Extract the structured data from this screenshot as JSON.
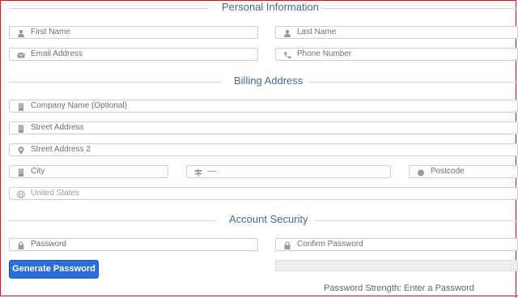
{
  "sections": {
    "personal": "Personal Information",
    "billing": "Billing Address",
    "security": "Account Security"
  },
  "fields": {
    "first_name": "First Name",
    "last_name": "Last Name",
    "email": "Email Address",
    "phone": "Phone Number",
    "company": "Company Name (Optional)",
    "street1": "Street Address",
    "street2": "Street Address 2",
    "city": "City",
    "state": "—",
    "postcode": "Postcode",
    "country": "United States",
    "password": "Password",
    "confirm_password": "Confirm Password"
  },
  "buttons": {
    "generate_password": "Generate Password"
  },
  "password_strength": {
    "text": "Password Strength: Enter a Password",
    "fill_percent": 0
  },
  "colors": {
    "section_title": "#456b8c",
    "button": "#2a6fd6",
    "frame": "#e0101a"
  },
  "icons": {
    "first_name": "user-icon",
    "last_name": "user-icon",
    "email": "envelope-icon",
    "phone": "phone-icon",
    "company": "building-icon",
    "street1": "building-icon",
    "street2": "map-marker-icon",
    "city": "building-icon",
    "state": "signpost-icon",
    "postcode": "dot-icon",
    "country": "globe-icon",
    "password": "lock-icon",
    "confirm_password": "lock-icon"
  }
}
